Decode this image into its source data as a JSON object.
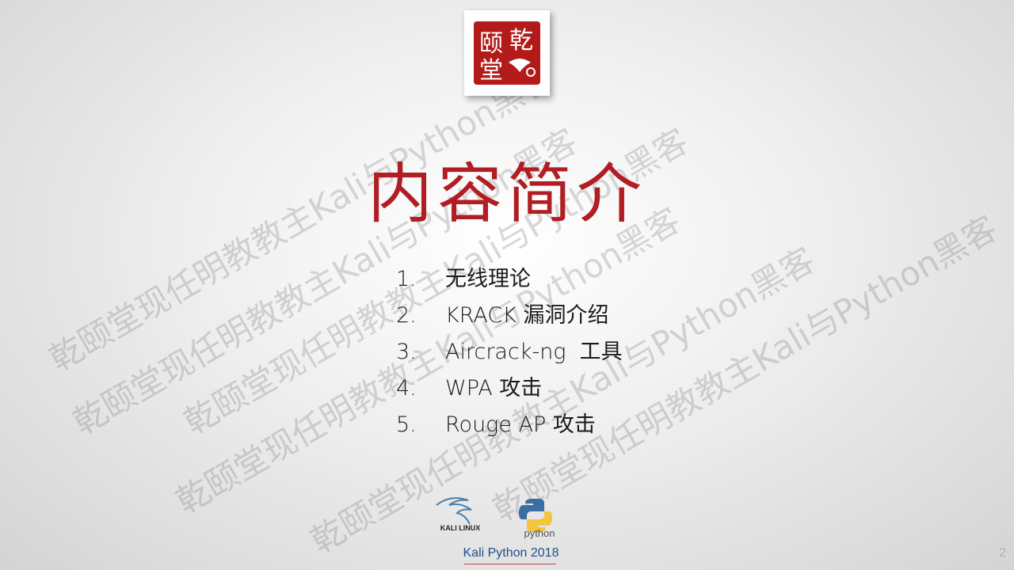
{
  "seal": {
    "text": "乾颐堂"
  },
  "title": "内容简介",
  "items": [
    {
      "num": "1.",
      "label": "无线理论"
    },
    {
      "num": "2.",
      "label": "KRACK 漏洞介绍"
    },
    {
      "num": "3.",
      "label": "Aircrack-ng  工具"
    },
    {
      "num": "4.",
      "label": "WPA 攻击"
    },
    {
      "num": "5.",
      "label": "Rouge AP 攻击"
    }
  ],
  "watermark": "乾颐堂现任明教教主Kali与Python黑客",
  "footer": {
    "kali_logo_text": "KALI LINUX",
    "python_logo_text": "python",
    "caption": "Kali Python 2018"
  },
  "page_number": "2"
}
